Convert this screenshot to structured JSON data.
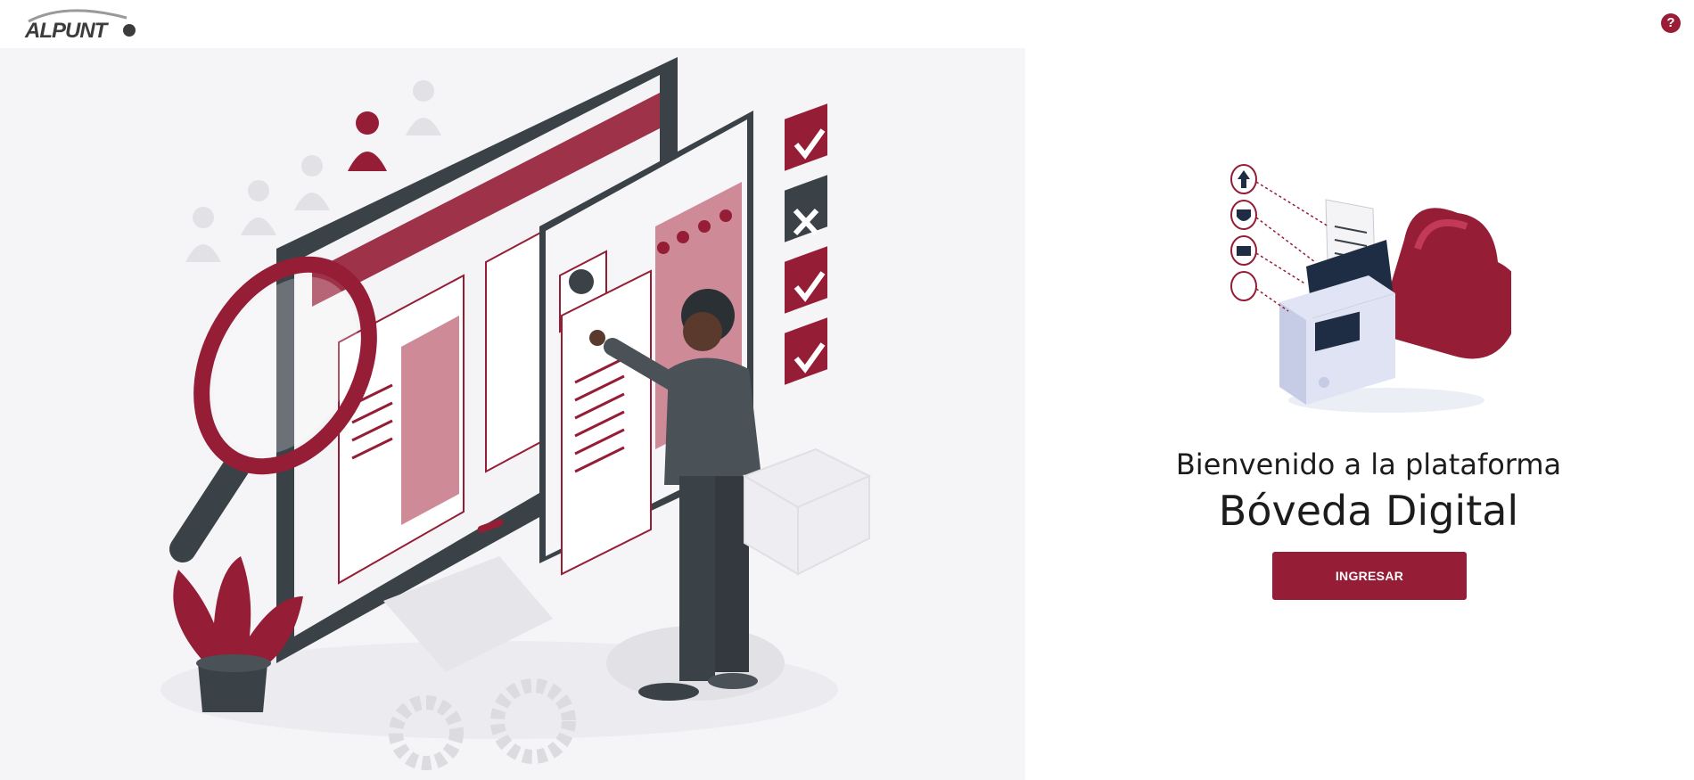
{
  "header": {
    "logo_text": "ALPUNTO",
    "help_label": "?"
  },
  "main": {
    "welcome_text": "Bienvenido a la plataforma",
    "product_name": "Bóveda Digital",
    "login_button_label": "INGRESAR"
  },
  "icons": [
    "help-icon",
    "upload-arrow-icon",
    "shield-icon",
    "folder-icon",
    "dot-icon"
  ],
  "colors": {
    "brand_primary": "#951d36",
    "illustration_bg": "#f5f5f8",
    "dark_slate": "#3a4248"
  }
}
